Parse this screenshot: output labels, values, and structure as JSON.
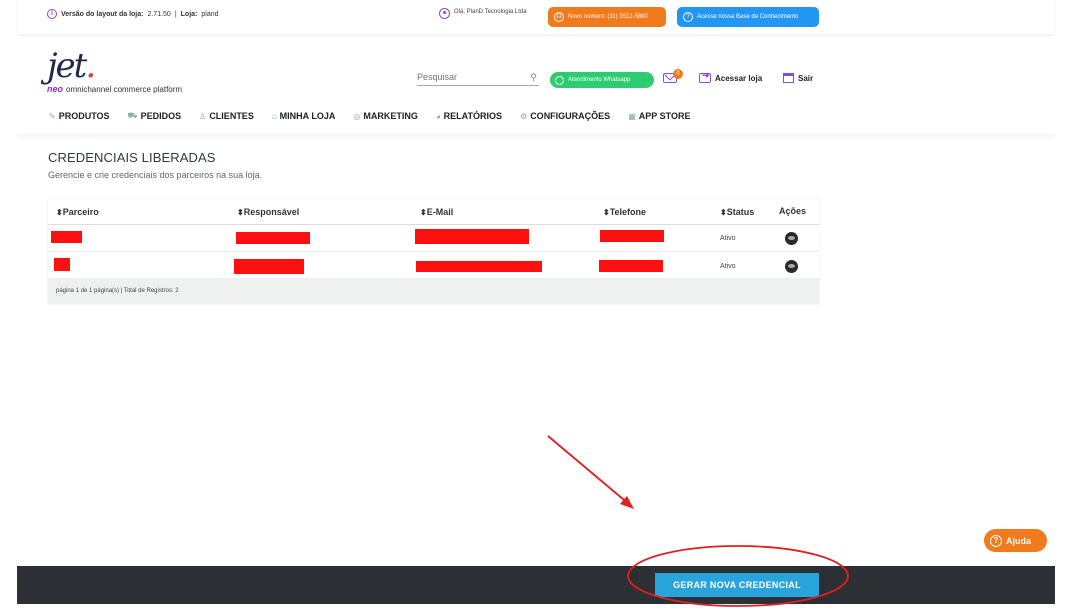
{
  "topbar": {
    "version_label": "Versão do layout da loja:",
    "version_value": "2.71.50",
    "separator": "|",
    "store_label": "Loja:",
    "store_value": "pland",
    "greeting": "Olá, PlanD Tecnologia Ltda",
    "phone_pill": "Novo número: (11) 3512-5880",
    "kb_pill": "Acesse nossa Base de Conhecimento"
  },
  "header": {
    "logo_text": "jet",
    "logo_dot": ".",
    "logo_neo": "neo",
    "logo_tagline": "omnichannel commerce platform",
    "search_placeholder": "Pesquisar",
    "whatsapp_label": "Atendimento Whatsapp",
    "mail_badge": "0",
    "access_store": "Acessar loja",
    "logout": "Sair"
  },
  "nav": {
    "items": [
      {
        "label": "PRODUTOS",
        "icon": "edit-icon"
      },
      {
        "label": "PEDIDOS",
        "icon": "cart-icon"
      },
      {
        "label": "CLIENTES",
        "icon": "user-icon"
      },
      {
        "label": "MINHA LOJA",
        "icon": "store-icon"
      },
      {
        "label": "MARKETING",
        "icon": "target-icon"
      },
      {
        "label": "RELATÓRIOS",
        "icon": "chart-icon"
      },
      {
        "label": "CONFIGURAÇÕES",
        "icon": "gears-icon"
      },
      {
        "label": "APP STORE",
        "icon": "apps-icon"
      }
    ]
  },
  "main": {
    "title": "CREDENCIAIS LIBERADAS",
    "subtitle": "Gerencie e crie credenciais dos parceiros na sua loja.",
    "table": {
      "headers": [
        "Parceiro",
        "Responsável",
        "E-Mail",
        "Telefone",
        "Status",
        "Ações"
      ],
      "sort_icon": "⬍",
      "rows": [
        {
          "status": "Ativo"
        },
        {
          "status": "Ativo"
        }
      ],
      "footer": "página 1 de 1 página(s) | Total de Registros: 2"
    }
  },
  "bottom": {
    "generate_button": "GERAR NOVA CREDENCIAL"
  },
  "help": {
    "label": "Ajuda"
  },
  "colors": {
    "accent_purple": "#8a4bd8",
    "orange": "#f07a1c",
    "blue": "#2196f3",
    "whatsapp": "#2ecc71",
    "button_blue": "#29a3dc",
    "redaction": "#ff1010",
    "annotation_red": "#e02020"
  }
}
